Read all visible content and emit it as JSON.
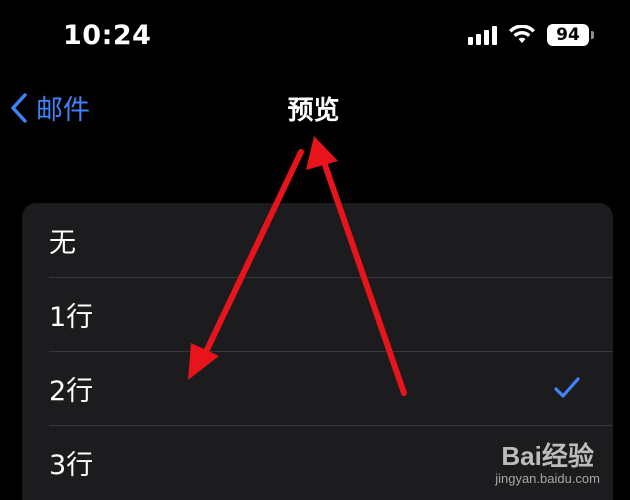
{
  "status_bar": {
    "time": "10:24",
    "battery_level": "94",
    "icons": [
      "cellular-signal-icon",
      "wifi-icon",
      "battery-icon"
    ]
  },
  "nav": {
    "back_label": "邮件",
    "title": "预览"
  },
  "options": [
    {
      "label": "无",
      "selected": false
    },
    {
      "label": "1行",
      "selected": false
    },
    {
      "label": "2行",
      "selected": true
    },
    {
      "label": "3行",
      "selected": false
    }
  ],
  "colors": {
    "background": "#000000",
    "list_background": "#1c1c1e",
    "accent_blue": "#3f83f8",
    "annotation_red": "#e8141b",
    "separator": "#38383a"
  },
  "watermark": {
    "brand": "Bai经验",
    "url": "jingyan.baidu.com"
  }
}
